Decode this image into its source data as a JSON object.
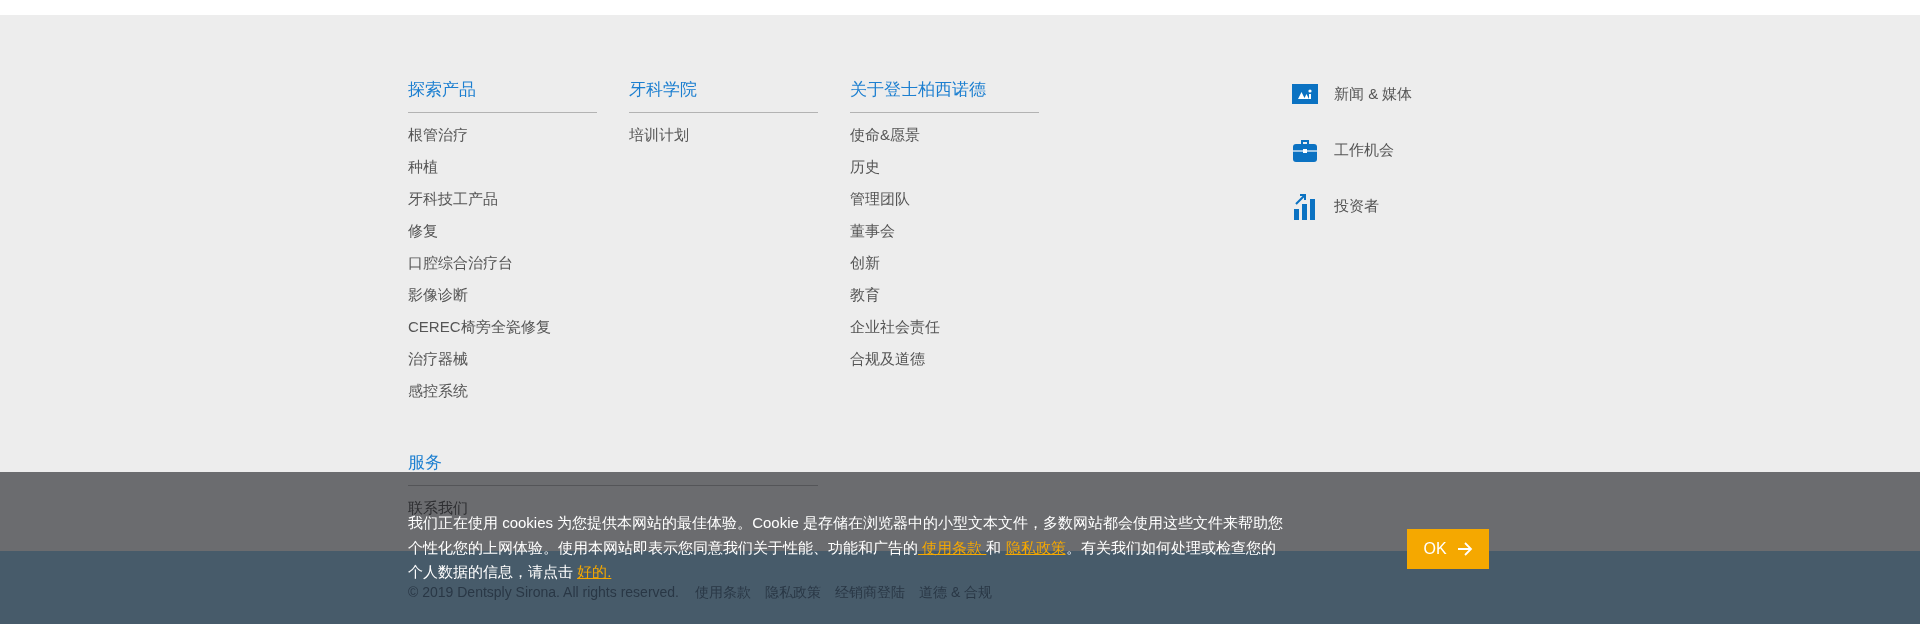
{
  "nav_columns": [
    {
      "heading": "探索产品",
      "links": [
        "根管治疗",
        "种植",
        "牙科技工产品",
        "修复",
        "口腔综合治疗台",
        "影像诊断",
        "CEREC椅旁全瓷修复",
        "治疗器械",
        "感控系统"
      ]
    },
    {
      "heading": "牙科学院",
      "links": [
        "培训计划"
      ]
    },
    {
      "heading": "关于登士柏西诺德",
      "links": [
        "使命&愿景",
        "历史",
        "管理团队",
        "董事会",
        "创新",
        "教育",
        "企业社会责任",
        "合规及道德"
      ]
    }
  ],
  "quick_links": [
    {
      "kind": "media",
      "label": "新闻 & 媒体"
    },
    {
      "kind": "jobs",
      "label": "工作机会"
    },
    {
      "kind": "investors",
      "label": "投资者"
    }
  ],
  "services": {
    "heading": "服务",
    "links": [
      "联系我们"
    ]
  },
  "legal": {
    "copyright": "© 2019 Dentsply Sirona. All rights reserved.",
    "links": [
      "使用条款",
      "隐私政策",
      "经销商登陆",
      "道德 & 合规"
    ]
  },
  "cookie_banner": {
    "parts": [
      {
        "kind": "text",
        "text": "我们正在使用 cookies 为您提供本网站的最佳体验。Cookie 是存储在浏览器中的小型文本文件，多数网站都会使用这些文件来帮助您个性化您的上网体验。使用本网站即表示您同意我们关于性能、功能和广告的"
      },
      {
        "kind": "link",
        "text": " 使用条款 "
      },
      {
        "kind": "text",
        "text": "和 "
      },
      {
        "kind": "link",
        "text": "隐私政策"
      },
      {
        "kind": "text",
        "text": "。有关我们如何处理或检查您的个人数据的信息，请点击 "
      },
      {
        "kind": "link",
        "text": "好的."
      }
    ],
    "button": "OK"
  }
}
